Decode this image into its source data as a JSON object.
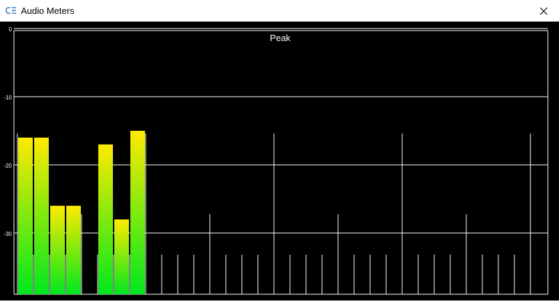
{
  "window": {
    "title": "Audio Meters",
    "close_icon": "close-icon",
    "app_icon": "audio-meter-app-icon"
  },
  "meter": {
    "label": "Peak",
    "scale_min_db": -40,
    "scale_max_db": 0,
    "scale_ticks": [
      "0",
      "-10",
      "-20",
      "-30"
    ],
    "colors": {
      "background": "#000000",
      "grid": "#ffffff",
      "level_top": "#ffea00",
      "level_bottom": "#00e81e"
    },
    "channel_levels_db": [
      -16,
      -16,
      -26,
      -26,
      null,
      -17,
      -28,
      -15,
      null,
      null,
      null,
      null,
      null,
      null,
      null,
      null,
      null,
      null,
      null,
      null,
      null,
      null,
      null,
      null,
      null,
      null,
      null,
      null,
      null,
      null,
      null,
      null
    ],
    "channel_marker_heights": [
      "tall",
      "short",
      "short",
      "short",
      "mid",
      "short",
      "short",
      "short",
      "tall",
      "short",
      "short",
      "short",
      "mid",
      "short",
      "short",
      "short",
      "tall",
      "short",
      "short",
      "short",
      "mid",
      "short",
      "short",
      "short",
      "tall",
      "short",
      "short",
      "short",
      "mid",
      "short",
      "short",
      "short",
      "tall"
    ]
  }
}
